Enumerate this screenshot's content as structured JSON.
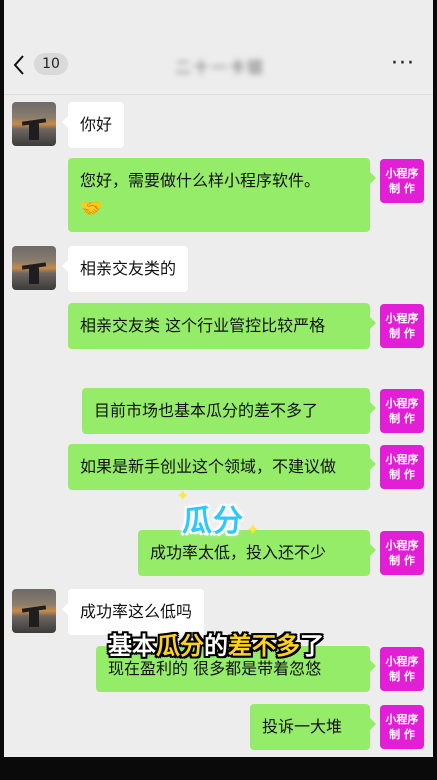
{
  "nav": {
    "unread_count": "10",
    "contact_name": "二十一卡银",
    "more": "···"
  },
  "tag": {
    "line1": "小程序",
    "line2": "制 作"
  },
  "messages": [
    {
      "side": "left",
      "text": "你好"
    },
    {
      "side": "right",
      "text": "您好，需要做什么样小程序软件。",
      "emoji": "🤝"
    },
    {
      "side": "left",
      "text": "相亲交友类的"
    },
    {
      "side": "right",
      "text": "相亲交友类 这个行业管控比较严格"
    },
    {
      "side": "right",
      "text": "目前市场也基本瓜分的差不多了"
    },
    {
      "side": "right",
      "text": "如果是新手创业这个领域，不建议做"
    },
    {
      "side": "right",
      "text": "成功率太低，投入还不少"
    },
    {
      "side": "left",
      "text": "成功率这么低吗"
    },
    {
      "side": "right",
      "text": "现在盈利的 很多都是带着忽悠"
    },
    {
      "side": "right",
      "text": "投诉一大堆"
    }
  ],
  "overlay": {
    "sticker": "瓜分",
    "caption_a": "基本",
    "caption_b": "瓜分",
    "caption_c": "的",
    "caption_d": "差不多",
    "caption_e": "了"
  }
}
